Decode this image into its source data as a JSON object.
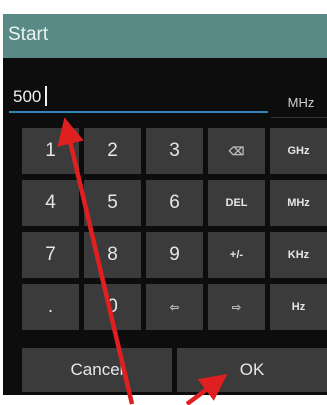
{
  "dialog": {
    "title": "Start",
    "input": {
      "value": "500",
      "unit": "MHz"
    }
  },
  "keypad": {
    "rows": [
      [
        "1",
        "2",
        "3",
        "backspace",
        "GHz"
      ],
      [
        "4",
        "5",
        "6",
        "DEL",
        "MHz"
      ],
      [
        "7",
        "8",
        "9",
        "+/-",
        "KHz"
      ],
      [
        ".",
        "0",
        "left",
        "right",
        "Hz"
      ]
    ],
    "icons": {
      "backspace": "⌫",
      "left": "⇦",
      "right": "⇨"
    }
  },
  "buttons": {
    "cancel": "Cancel",
    "ok": "OK"
  },
  "annotations": {
    "arrow_color": "#e02020"
  }
}
